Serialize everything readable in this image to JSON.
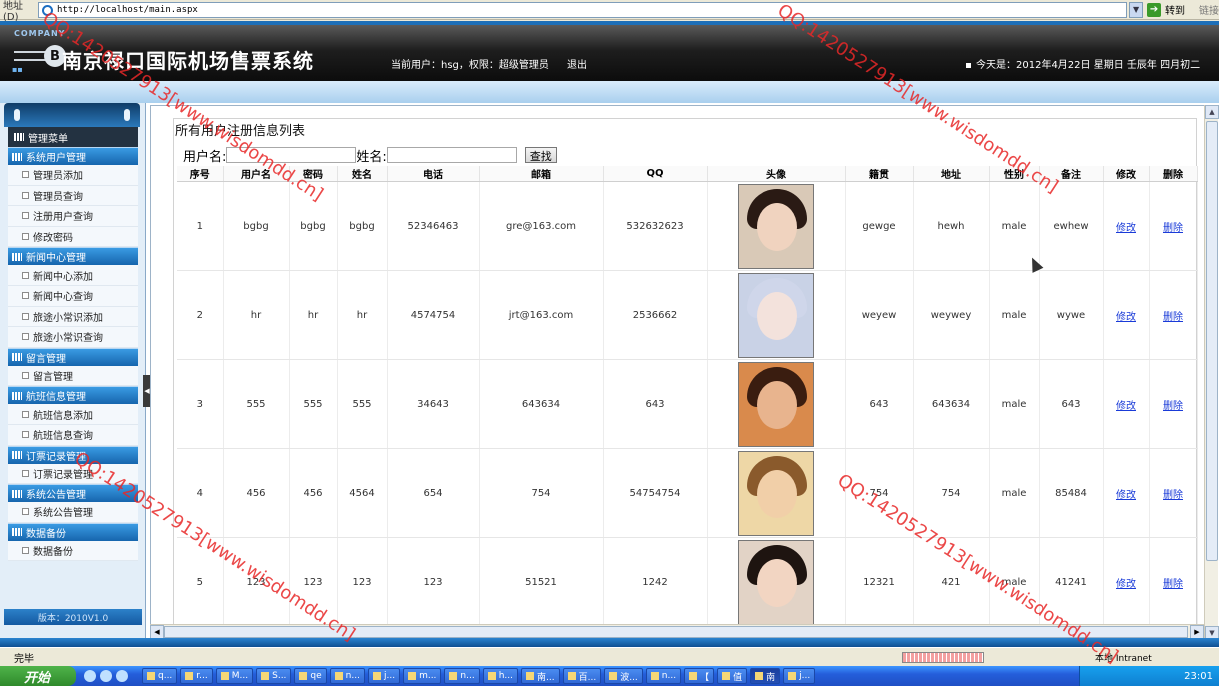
{
  "browser": {
    "address_label": "地址(D)",
    "url": "http://localhost/main.aspx",
    "go_label": "转到",
    "links_label": "链接",
    "status_text": "完毕",
    "zone_text": "本地 Intranet"
  },
  "header": {
    "company": "COMPANY",
    "badge": "B",
    "title": "南京禄口国际机场售票系统",
    "current_user": "当前用户：hsg，权限：超级管理员",
    "logout": "退出",
    "date": "今天是：2012年4月22日 星期日 壬辰年 四月初二"
  },
  "sidebar": {
    "menu_title": "管理菜单",
    "version": "版本：2010V1.0",
    "groups": [
      {
        "title": "系统用户管理",
        "items": [
          "管理员添加",
          "管理员查询",
          "注册用户查询",
          "修改密码"
        ]
      },
      {
        "title": "新闻中心管理",
        "items": [
          "新闻中心添加",
          "新闻中心查询",
          "旅途小常识添加",
          "旅途小常识查询"
        ]
      },
      {
        "title": "留言管理",
        "items": [
          "留言管理"
        ]
      },
      {
        "title": "航班信息管理",
        "items": [
          "航班信息添加",
          "航班信息查询"
        ]
      },
      {
        "title": "订票记录管理",
        "items": [
          "订票记录管理"
        ]
      },
      {
        "title": "系统公告管理",
        "items": [
          "系统公告管理"
        ]
      },
      {
        "title": "数据备份",
        "items": [
          "数据备份"
        ]
      }
    ]
  },
  "content": {
    "panel_title": "所有用户注册信息列表",
    "search": {
      "username_label": "用户名:",
      "name_label": "姓名:",
      "button": "查找",
      "username_value": "",
      "name_value": ""
    },
    "columns": [
      "序号",
      "用户名",
      "密码",
      "姓名",
      "电话",
      "邮箱",
      "QQ",
      "头像",
      "籍贯",
      "地址",
      "性别",
      "备注",
      "修改",
      "删除"
    ],
    "edit_label": "修改",
    "delete_label": "删除",
    "rows": [
      {
        "no": "1",
        "username": "bgbg",
        "password": "bgbg",
        "name": "bgbg",
        "phone": "52346463",
        "email": "gre@163.com",
        "qq": "532632623",
        "native": "gewge",
        "address": "hewh",
        "gender": "male",
        "remark": "ewhew",
        "avatar": "portrait-1"
      },
      {
        "no": "2",
        "username": "hr",
        "password": "hr",
        "name": "hr",
        "phone": "4574754",
        "email": "jrt@163.com",
        "qq": "2536662",
        "native": "weyew",
        "address": "weywey",
        "gender": "male",
        "remark": "wywe",
        "avatar": "portrait-2"
      },
      {
        "no": "3",
        "username": "555",
        "password": "555",
        "name": "555",
        "phone": "34643",
        "email": "643634",
        "qq": "643",
        "native": "643",
        "address": "643634",
        "gender": "male",
        "remark": "643",
        "avatar": "portrait-3"
      },
      {
        "no": "4",
        "username": "456",
        "password": "456",
        "name": "4564",
        "phone": "654",
        "email": "754",
        "qq": "54754754",
        "native": "754",
        "address": "754",
        "gender": "male",
        "remark": "85484",
        "avatar": "portrait-4"
      },
      {
        "no": "5",
        "username": "123",
        "password": "123",
        "name": "123",
        "phone": "123",
        "email": "51521",
        "qq": "1242",
        "native": "12321",
        "address": "421",
        "gender": "male",
        "remark": "41241",
        "avatar": "portrait-5"
      }
    ]
  },
  "watermark": "QQ:1420527913[www.wisdomdd.cn]",
  "taskbar": {
    "start": "开始",
    "clock": "23:01",
    "buttons": [
      "q...",
      "r...",
      "M...",
      "S...",
      "qe",
      "n...",
      "j...",
      "m...",
      "n...",
      "h...",
      "南...",
      "百...",
      "波...",
      "n...",
      "【",
      "值",
      "南",
      "j..."
    ],
    "active_index": 16
  }
}
